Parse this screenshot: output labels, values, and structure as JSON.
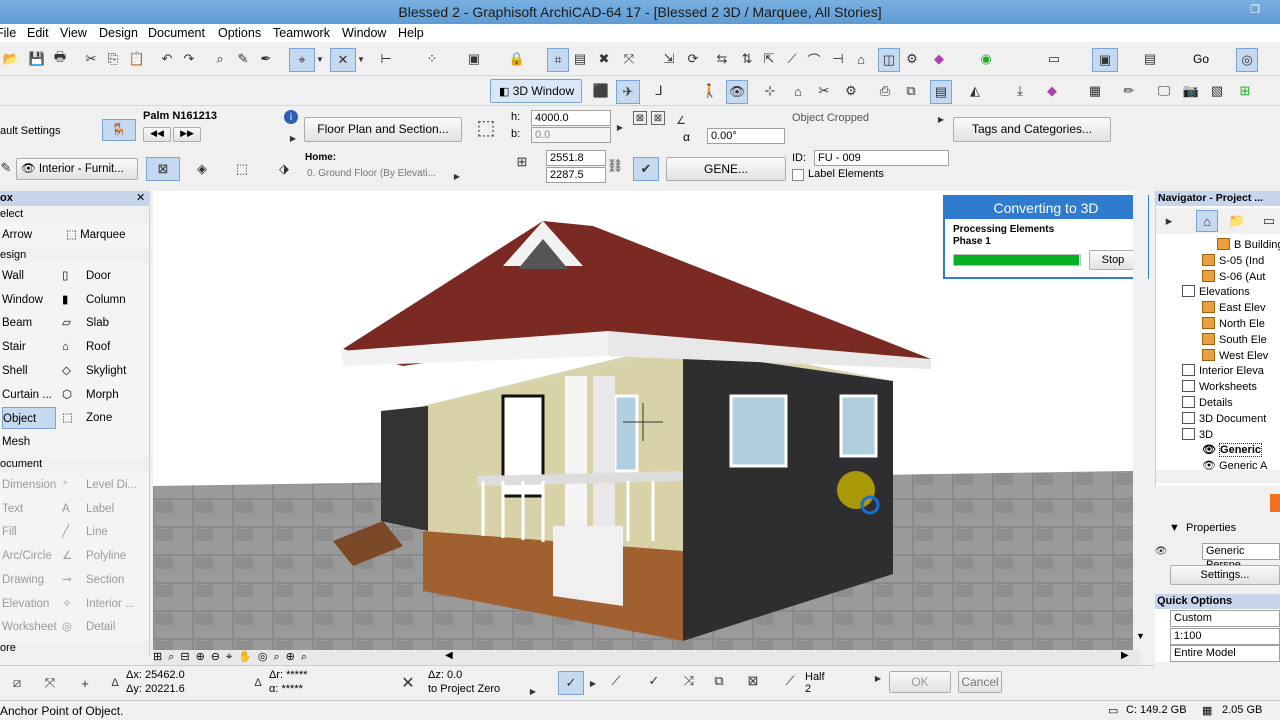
{
  "window": {
    "title": "Blessed 2 - Graphisoft ArchiCAD-64 17 - [Blessed 2 3D / Marquee, All Stories]"
  },
  "menu": [
    "File",
    "Edit",
    "View",
    "Design",
    "Document",
    "Options",
    "Teamwork",
    "Window",
    "Help"
  ],
  "toolbar": {
    "view_3d": "3D Window",
    "goto": "Go"
  },
  "info": {
    "settings": "ault Settings",
    "object_name": "Palm N161213",
    "floor_plan_btn": "Floor Plan and Section...",
    "h_label": "h:",
    "h_value": "4000.0",
    "b_label": "b:",
    "b_value": "0.0",
    "angle_value": "0.00°",
    "alpha": "α",
    "object_cropped": "Object Cropped",
    "tags_btn": "Tags and Categories...",
    "layer": "Interior - Furnit...",
    "home_label": "Home:",
    "home_value": "0. Ground Floor (By Elevati...",
    "dim1": "2551.8",
    "dim2": "2287.5",
    "gene_btn": "GENE...",
    "id_label": "ID:",
    "id_value": "FU - 009",
    "label_elements": "Label Elements"
  },
  "toolbox": {
    "title": "ox",
    "select_section": "elect",
    "select_tools": [
      {
        "label": "Arrow"
      },
      {
        "label": "Marquee"
      }
    ],
    "design_section": "esign",
    "design_tools": [
      {
        "left": "Wall",
        "right": "Door"
      },
      {
        "left": "Window",
        "right": "Column"
      },
      {
        "left": "Beam",
        "right": "Slab"
      },
      {
        "left": "Stair",
        "right": "Roof"
      },
      {
        "left": "Shell",
        "right": "Skylight"
      },
      {
        "left": "Curtain ...",
        "right": "Morph"
      },
      {
        "left": "Object",
        "right": "Zone"
      },
      {
        "left": "Mesh",
        "right": ""
      }
    ],
    "document_section": "ocument",
    "doc_tools": [
      {
        "left": "Dimension",
        "right": "Level Di..."
      },
      {
        "left": "Text",
        "right": "Label"
      },
      {
        "left": "Fill",
        "right": "Line"
      },
      {
        "left": "Arc/Circle",
        "right": "Polyline"
      },
      {
        "left": "Drawing",
        "right": "Section"
      },
      {
        "left": "Elevation",
        "right": "Interior ..."
      },
      {
        "left": "Worksheet",
        "right": "Detail"
      }
    ],
    "more": "ore"
  },
  "dialog": {
    "title": "Converting to 3D",
    "line1": "Processing Elements",
    "line2": "Phase 1",
    "progress": 0.99,
    "stop": "Stop"
  },
  "navigator": {
    "title": "Navigator - Project ...",
    "items": [
      "B Building",
      "S-05 (Ind",
      "S-06 (Aut",
      "Elevations",
      "East Elev",
      "North Ele",
      "South Ele",
      "West Elev",
      "Interior Eleva",
      "Worksheets",
      "Details",
      "3D Document",
      "3D",
      "Generic",
      "Generic A"
    ]
  },
  "properties": {
    "label": "Properties",
    "value": "Generic Perspe",
    "settings": "Settings..."
  },
  "quick": {
    "title": "Quick Options",
    "custom": "Custom",
    "scale": "1:100",
    "model": "Entire Model"
  },
  "coords": {
    "ax": "Δx: 25462.0",
    "ay": "Δy: 20221.6",
    "ar": "Δr: *****",
    "aa": "α: *****",
    "az": "Δz: 0.0",
    "to": "to Project Zero",
    "half": "Half",
    "two": "2",
    "ok": "OK",
    "cancel": "Cancel"
  },
  "status": {
    "msg": "Anchor Point of Object.",
    "disk": "C: 149.2 GB",
    "mem": "2.05 GB"
  }
}
